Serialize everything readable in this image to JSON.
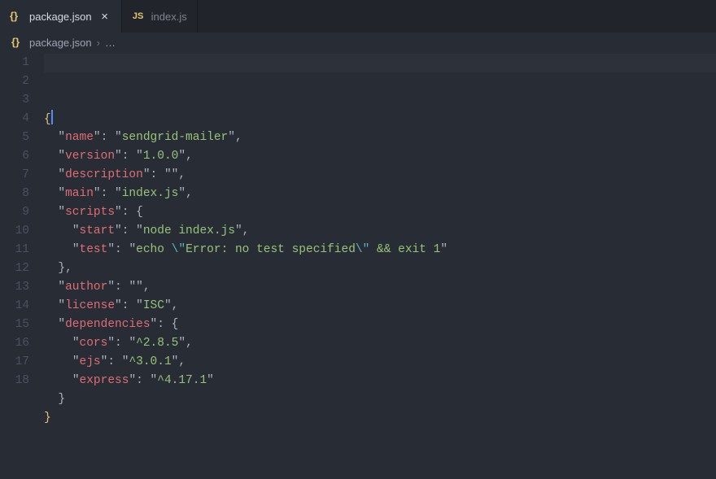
{
  "tabs": [
    {
      "label": "package.json",
      "icon": "json-icon",
      "active": true
    },
    {
      "label": "index.js",
      "icon": "js-icon",
      "active": false
    }
  ],
  "breadcrumb": {
    "file": "package.json",
    "ellipsis": "…"
  },
  "editor": {
    "active_line": 1,
    "line_count": 18,
    "lines": [
      {
        "n": 1,
        "indent": 0,
        "tokens": [
          {
            "t": "{",
            "c": "brace"
          }
        ],
        "cursor_after": 0
      },
      {
        "n": 2,
        "indent": 1,
        "tokens": [
          {
            "t": "\"",
            "c": "punct"
          },
          {
            "t": "name",
            "c": "key"
          },
          {
            "t": "\"",
            "c": "punct"
          },
          {
            "t": ": ",
            "c": "punct"
          },
          {
            "t": "\"",
            "c": "punct"
          },
          {
            "t": "sendgrid-mailer",
            "c": "str"
          },
          {
            "t": "\"",
            "c": "punct"
          },
          {
            "t": ",",
            "c": "punct"
          }
        ]
      },
      {
        "n": 3,
        "indent": 1,
        "tokens": [
          {
            "t": "\"",
            "c": "punct"
          },
          {
            "t": "version",
            "c": "key"
          },
          {
            "t": "\"",
            "c": "punct"
          },
          {
            "t": ": ",
            "c": "punct"
          },
          {
            "t": "\"",
            "c": "punct"
          },
          {
            "t": "1.0.0",
            "c": "str"
          },
          {
            "t": "\"",
            "c": "punct"
          },
          {
            "t": ",",
            "c": "punct"
          }
        ]
      },
      {
        "n": 4,
        "indent": 1,
        "tokens": [
          {
            "t": "\"",
            "c": "punct"
          },
          {
            "t": "description",
            "c": "key"
          },
          {
            "t": "\"",
            "c": "punct"
          },
          {
            "t": ": ",
            "c": "punct"
          },
          {
            "t": "\"",
            "c": "punct"
          },
          {
            "t": "\"",
            "c": "punct"
          },
          {
            "t": ",",
            "c": "punct"
          }
        ]
      },
      {
        "n": 5,
        "indent": 1,
        "tokens": [
          {
            "t": "\"",
            "c": "punct"
          },
          {
            "t": "main",
            "c": "key"
          },
          {
            "t": "\"",
            "c": "punct"
          },
          {
            "t": ": ",
            "c": "punct"
          },
          {
            "t": "\"",
            "c": "punct"
          },
          {
            "t": "index.js",
            "c": "str"
          },
          {
            "t": "\"",
            "c": "punct"
          },
          {
            "t": ",",
            "c": "punct"
          }
        ]
      },
      {
        "n": 6,
        "indent": 1,
        "tokens": [
          {
            "t": "\"",
            "c": "punct"
          },
          {
            "t": "scripts",
            "c": "key"
          },
          {
            "t": "\"",
            "c": "punct"
          },
          {
            "t": ": ",
            "c": "punct"
          },
          {
            "t": "{",
            "c": "brace0"
          }
        ]
      },
      {
        "n": 7,
        "indent": 2,
        "tokens": [
          {
            "t": "\"",
            "c": "punct"
          },
          {
            "t": "start",
            "c": "key"
          },
          {
            "t": "\"",
            "c": "punct"
          },
          {
            "t": ": ",
            "c": "punct"
          },
          {
            "t": "\"",
            "c": "punct"
          },
          {
            "t": "node index.js",
            "c": "str"
          },
          {
            "t": "\"",
            "c": "punct"
          },
          {
            "t": ",",
            "c": "punct"
          }
        ]
      },
      {
        "n": 8,
        "indent": 2,
        "tokens": [
          {
            "t": "\"",
            "c": "punct"
          },
          {
            "t": "test",
            "c": "key"
          },
          {
            "t": "\"",
            "c": "punct"
          },
          {
            "t": ": ",
            "c": "punct"
          },
          {
            "t": "\"",
            "c": "punct"
          },
          {
            "t": "echo ",
            "c": "str"
          },
          {
            "t": "\\\"",
            "c": "esc"
          },
          {
            "t": "Error: no test specified",
            "c": "str"
          },
          {
            "t": "\\\"",
            "c": "esc"
          },
          {
            "t": " && exit 1",
            "c": "str"
          },
          {
            "t": "\"",
            "c": "punct"
          }
        ]
      },
      {
        "n": 9,
        "indent": 1,
        "tokens": [
          {
            "t": "}",
            "c": "brace0"
          },
          {
            "t": ",",
            "c": "punct"
          }
        ]
      },
      {
        "n": 10,
        "indent": 1,
        "tokens": [
          {
            "t": "\"",
            "c": "punct"
          },
          {
            "t": "author",
            "c": "key"
          },
          {
            "t": "\"",
            "c": "punct"
          },
          {
            "t": ": ",
            "c": "punct"
          },
          {
            "t": "\"",
            "c": "punct"
          },
          {
            "t": "\"",
            "c": "punct"
          },
          {
            "t": ",",
            "c": "punct"
          }
        ]
      },
      {
        "n": 11,
        "indent": 1,
        "tokens": [
          {
            "t": "\"",
            "c": "punct"
          },
          {
            "t": "license",
            "c": "key"
          },
          {
            "t": "\"",
            "c": "punct"
          },
          {
            "t": ": ",
            "c": "punct"
          },
          {
            "t": "\"",
            "c": "punct"
          },
          {
            "t": "ISC",
            "c": "str"
          },
          {
            "t": "\"",
            "c": "punct"
          },
          {
            "t": ",",
            "c": "punct"
          }
        ]
      },
      {
        "n": 12,
        "indent": 1,
        "tokens": [
          {
            "t": "\"",
            "c": "punct"
          },
          {
            "t": "dependencies",
            "c": "key"
          },
          {
            "t": "\"",
            "c": "punct"
          },
          {
            "t": ": ",
            "c": "punct"
          },
          {
            "t": "{",
            "c": "brace0"
          }
        ]
      },
      {
        "n": 13,
        "indent": 2,
        "tokens": [
          {
            "t": "\"",
            "c": "punct"
          },
          {
            "t": "cors",
            "c": "key"
          },
          {
            "t": "\"",
            "c": "punct"
          },
          {
            "t": ": ",
            "c": "punct"
          },
          {
            "t": "\"",
            "c": "punct"
          },
          {
            "t": "^2.8.5",
            "c": "str"
          },
          {
            "t": "\"",
            "c": "punct"
          },
          {
            "t": ",",
            "c": "punct"
          }
        ]
      },
      {
        "n": 14,
        "indent": 2,
        "tokens": [
          {
            "t": "\"",
            "c": "punct"
          },
          {
            "t": "ejs",
            "c": "key"
          },
          {
            "t": "\"",
            "c": "punct"
          },
          {
            "t": ": ",
            "c": "punct"
          },
          {
            "t": "\"",
            "c": "punct"
          },
          {
            "t": "^3.0.1",
            "c": "str"
          },
          {
            "t": "\"",
            "c": "punct"
          },
          {
            "t": ",",
            "c": "punct"
          }
        ]
      },
      {
        "n": 15,
        "indent": 2,
        "tokens": [
          {
            "t": "\"",
            "c": "punct"
          },
          {
            "t": "express",
            "c": "key"
          },
          {
            "t": "\"",
            "c": "punct"
          },
          {
            "t": ": ",
            "c": "punct"
          },
          {
            "t": "\"",
            "c": "punct"
          },
          {
            "t": "^4.17.1",
            "c": "str"
          },
          {
            "t": "\"",
            "c": "punct"
          }
        ]
      },
      {
        "n": 16,
        "indent": 1,
        "tokens": [
          {
            "t": "}",
            "c": "brace0"
          }
        ]
      },
      {
        "n": 17,
        "indent": 0,
        "tokens": [
          {
            "t": "}",
            "c": "brace"
          }
        ]
      },
      {
        "n": 18,
        "indent": 0,
        "tokens": []
      }
    ]
  }
}
